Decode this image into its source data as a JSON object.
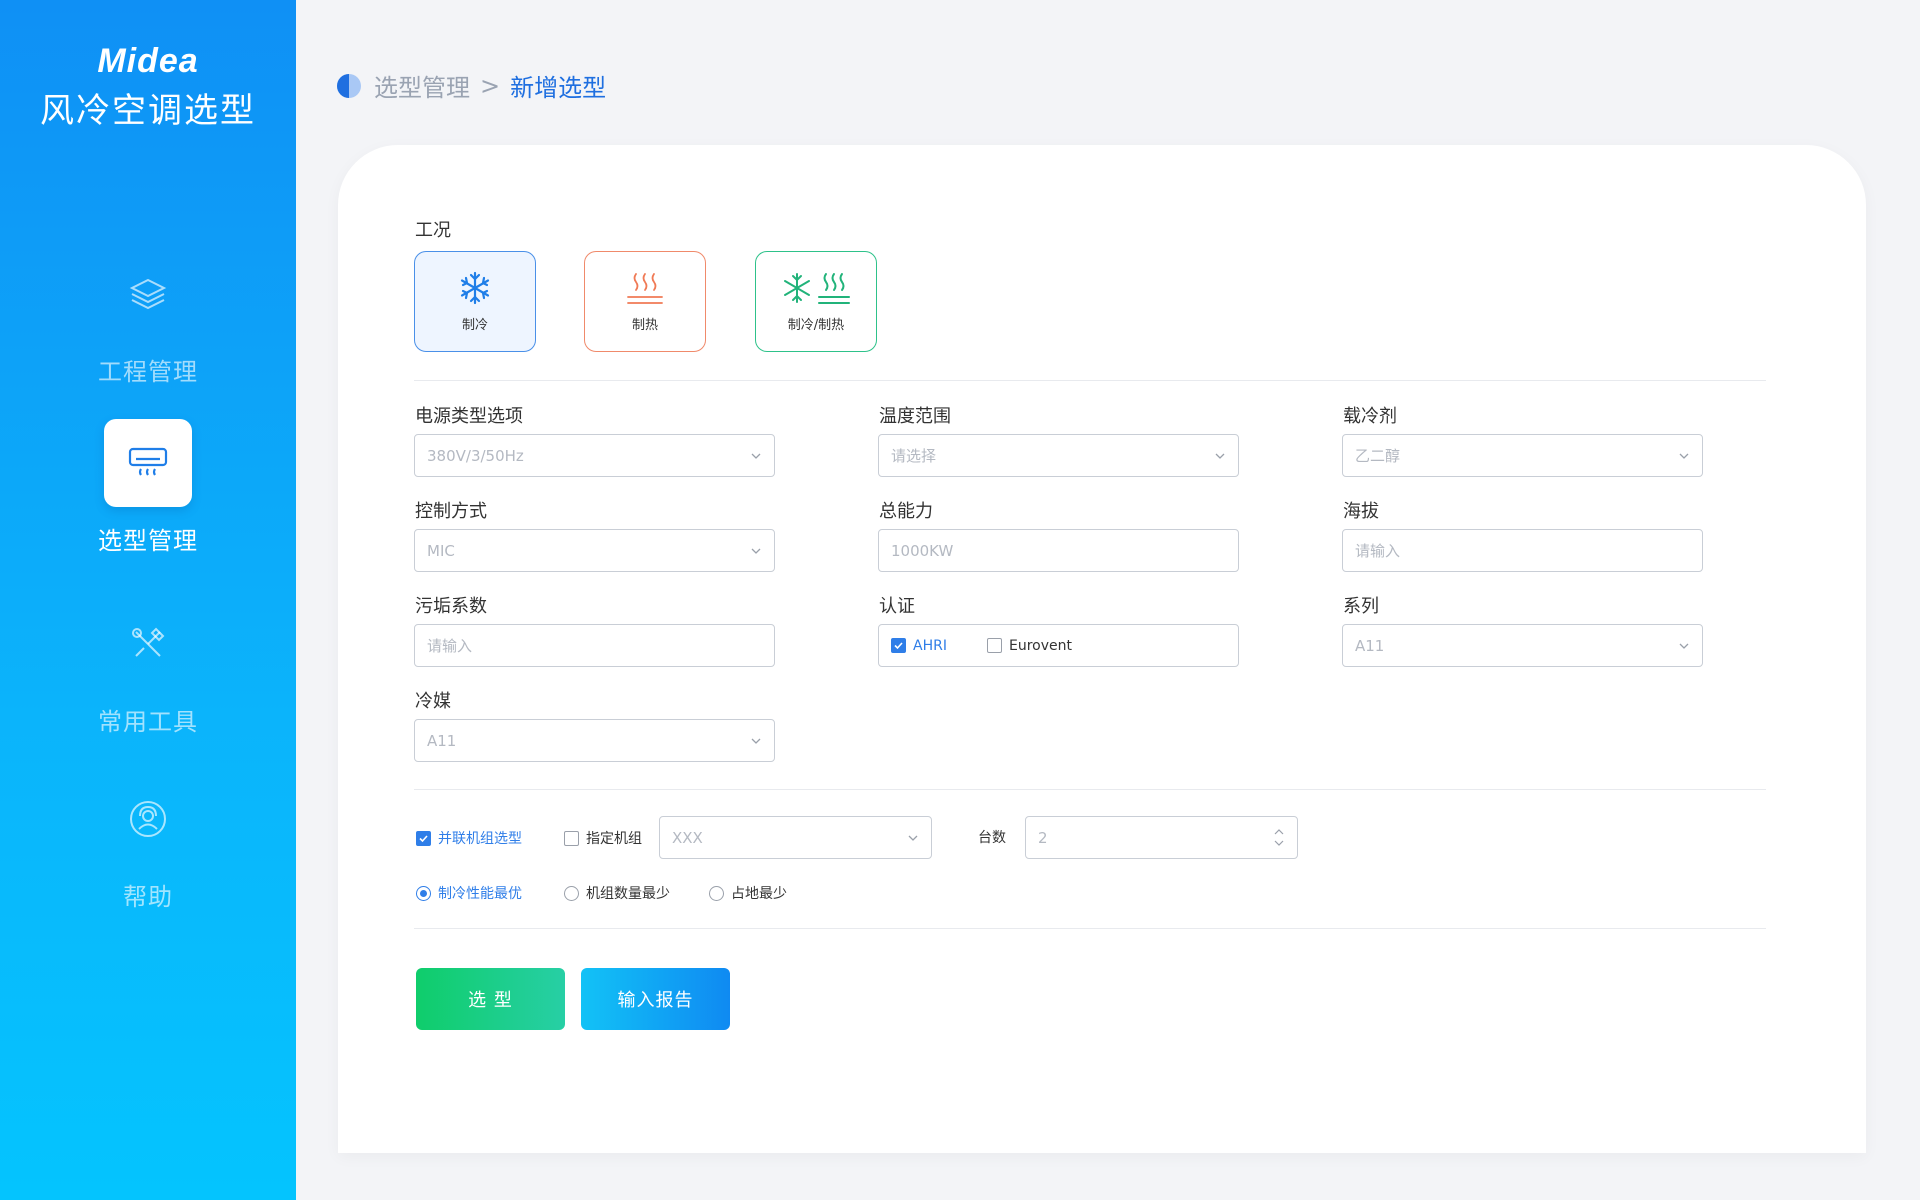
{
  "sidebar": {
    "brand": "Midea",
    "app_title": "风冷空调选型",
    "items": [
      {
        "label": "工程管理",
        "icon": "layers-icon"
      },
      {
        "label": "选型管理",
        "icon": "air-conditioner-icon"
      },
      {
        "label": "常用工具",
        "icon": "tools-icon"
      },
      {
        "label": "帮助",
        "icon": "support-agent-icon"
      }
    ]
  },
  "breadcrumb": {
    "parent": "选型管理",
    "separator": ">",
    "current": "新增选型"
  },
  "conditions": {
    "title": "工况",
    "modes": [
      {
        "label": "制冷",
        "icon": "snowflake-icon"
      },
      {
        "label": "制热",
        "icon": "heat-waves-icon"
      },
      {
        "label": "制冷/制热",
        "icon": "snowflake-heat-icon"
      }
    ],
    "selected": "制冷"
  },
  "form": {
    "power_type": {
      "label": "电源类型选项",
      "value": "380V/3/50Hz"
    },
    "temp_range": {
      "label": "温度范围",
      "placeholder": "请选择"
    },
    "coolant": {
      "label": "载冷剂",
      "value": "乙二醇"
    },
    "control_mode": {
      "label": "控制方式",
      "value": "MIC"
    },
    "total_capacity": {
      "label": "总能力",
      "value": "1000KW"
    },
    "altitude": {
      "label": "海拔",
      "placeholder": "请输入"
    },
    "fouling": {
      "label": "污垢系数",
      "placeholder": "请输入"
    },
    "certification": {
      "label": "认证",
      "options": [
        {
          "label": "AHRI",
          "checked": true
        },
        {
          "label": "Eurovent",
          "checked": false
        }
      ]
    },
    "series": {
      "label": "系列",
      "value": "A11"
    },
    "refrigerant": {
      "label": "冷媒",
      "value": "A11"
    }
  },
  "options": {
    "parallel": {
      "label": "并联机组选型",
      "checked": true
    },
    "specified": {
      "label": "指定机组",
      "checked": false
    },
    "unit_select": {
      "value": "XXX"
    },
    "count": {
      "label": "台数",
      "value": "2"
    },
    "radios": [
      {
        "label": "制冷性能最优",
        "checked": true
      },
      {
        "label": "机组数量最少",
        "checked": false
      },
      {
        "label": "占地最少",
        "checked": false
      }
    ]
  },
  "actions": {
    "select": "选 型",
    "report": "输入报告"
  },
  "colors": {
    "primary": "#2f7ee8",
    "sidebar_top": "#0f90f5",
    "sidebar_bottom": "#04c4fe",
    "select_btn": "#0fcd6b",
    "report_btn": "#0f8af2"
  }
}
